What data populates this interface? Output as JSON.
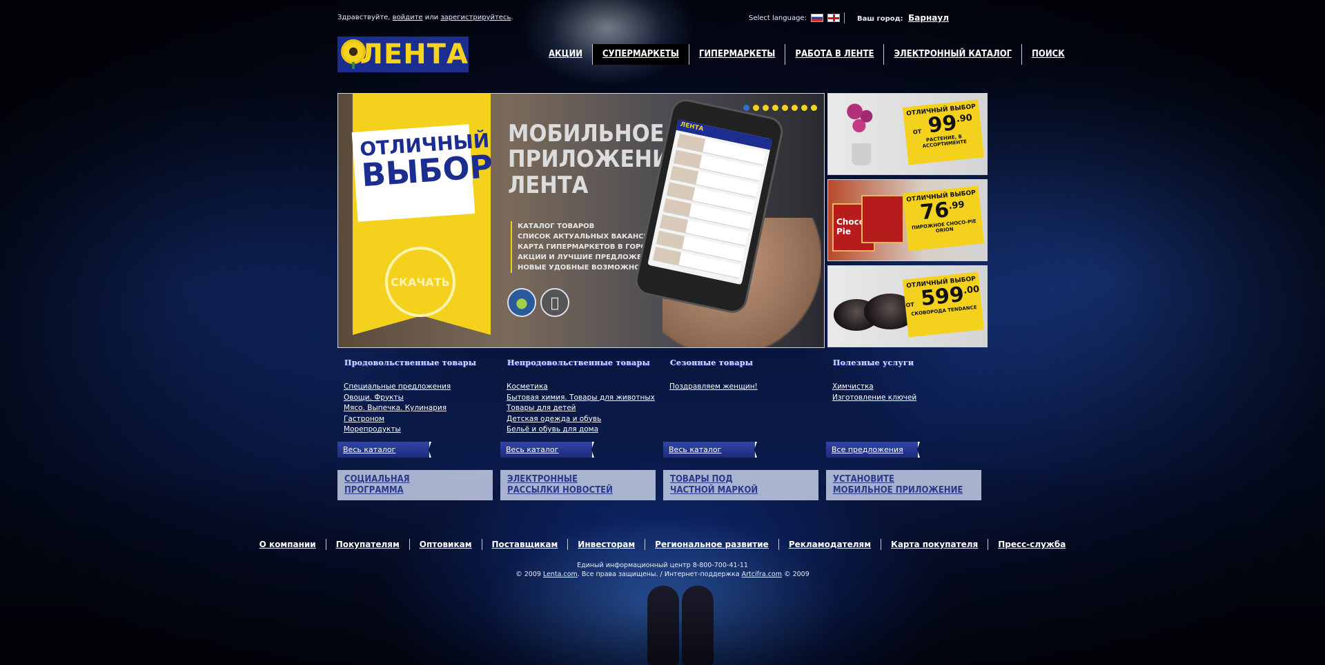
{
  "topbar": {
    "greeting_prefix": "Здравствуйте,",
    "login_link": "войдите",
    "or": "или",
    "register_link": "зарегистрируйтесь",
    "greeting_suffix": ".",
    "select_language": "Select language:",
    "your_city_label": "Ваш город:",
    "city": "Барнаул"
  },
  "logo": {
    "text": "ЛЕНТА",
    "brand_color": "#f7d31a",
    "bg_color": "#1b2e8f"
  },
  "menu": [
    {
      "label": "АКЦИИ"
    },
    {
      "label": "СУПЕРМАРКЕТЫ",
      "active": true
    },
    {
      "label": "ГИПЕРМАРКЕТЫ"
    },
    {
      "label": "РАБОТА В ЛЕНТЕ"
    },
    {
      "label": "ЭЛЕКТРОННЫЙ КАТАЛОГ"
    },
    {
      "label": "ПОИСК"
    }
  ],
  "banner": {
    "card_line1": "ОТЛИЧНЫЙ",
    "card_line2": "ВЫБОР",
    "download": "СКАЧАТЬ",
    "headline_1": "МОБИЛЬНОЕ",
    "headline_2": "ПРИЛОЖЕНИЕ",
    "headline_3": "ЛЕНТА",
    "bullets": [
      "КАТАЛОГ ТОВАРОВ",
      "СПИСОК АКТУАЛЬНЫХ ВАКАНСИЙ",
      "КАРТА ГИПЕРМАРКЕТОВ В ГОРОДЕ",
      "АКЦИИ И ЛУЧШИЕ ПРЕДЛОЖЕНИЯ",
      "НОВЫЕ УДОБНЫЕ ВОЗМОЖНОСТИ"
    ],
    "phone_brand": "ЛЕНТА",
    "slide_count": 8,
    "active_slide": 1
  },
  "promos": [
    {
      "title": "ОТЛИЧНЫЙ ВЫБОР",
      "from": "ОТ",
      "price": "99",
      "cents": ".90",
      "caption": "РАСТЕНИЕ, В АССОРТИМЕНТЕ"
    },
    {
      "title": "ОТЛИЧНЫЙ ВЫБОР",
      "from": "",
      "price": "76",
      "cents": ".99",
      "caption": "ПИРОЖНОЕ CHOCO-PIE ORION",
      "box_text": "Choco-Pie"
    },
    {
      "title": "ОТЛИЧНЫЙ ВЫБОР",
      "from": "ОТ",
      "price": "599",
      "cents": ".00",
      "caption": "СКОВОРОДА TENDANCE"
    }
  ],
  "categories": [
    {
      "title": "Продовольственные товары",
      "links": [
        "Специальные предложения",
        "Овощи. Фрукты",
        "Мясо. Выпечка. Кулинария",
        "Гастроном",
        "Морепродукты"
      ],
      "button": "Весь каталог"
    },
    {
      "title": "Непродовольственные товары",
      "links": [
        "Косметика",
        "Бытовая химия. Товары для животных",
        "Товары для детей",
        "Детская одежда и обувь",
        "Бельё и обувь для дома"
      ],
      "button": "Весь каталог"
    },
    {
      "title": "Сезонные товары",
      "links": [
        "Поздравляем женщин!"
      ],
      "button": "Весь каталог"
    },
    {
      "title": "Полезные услуги",
      "links": [
        "Химчистка",
        "Изготовление ключей"
      ],
      "button": "Все предложения"
    }
  ],
  "tiles": [
    {
      "line1": "СОЦИАЛЬНАЯ",
      "line2": "ПРОГРАММА"
    },
    {
      "line1": "ЭЛЕКТРОННЫЕ",
      "line2": "РАССЫЛКИ НОВОСТЕЙ"
    },
    {
      "line1": "ТОВАРЫ ПОД",
      "line2": "ЧАСТНОЙ МАРКОЙ"
    },
    {
      "line1": "УСТАНОВИТЕ",
      "line2": "МОБИЛЬНОЕ ПРИЛОЖЕНИЕ"
    }
  ],
  "footer": {
    "links": [
      "О компании",
      "Покупателям",
      "Оптовикам",
      "Поставщикам",
      "Инвесторам",
      "Региональное развитие",
      "Рекламодателям",
      "Карта покупателя",
      "Пресс-служба"
    ],
    "info_line": "Единый информационный центр 8-800-700-41-11",
    "copyright_prefix": "© 2009",
    "site_link": "Lenta.com",
    "copyright_mid": ". Все права защищены. / Интернет-поддержка",
    "support_link": "Artcifra.com",
    "copyright_suffix": "© 2009"
  }
}
